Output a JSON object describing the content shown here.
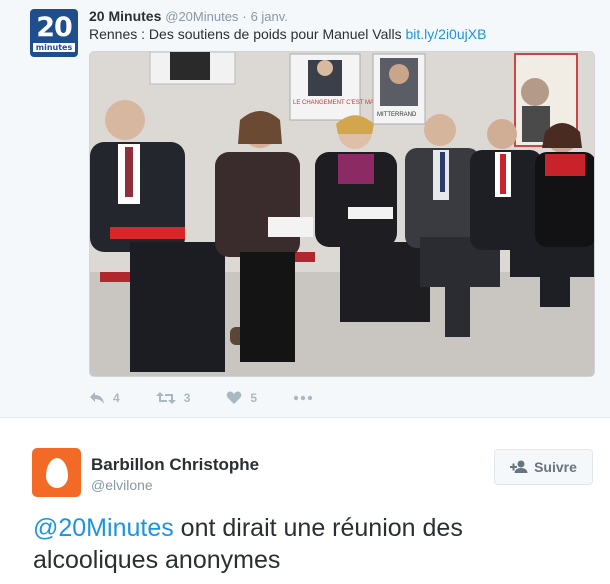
{
  "quoted_tweet": {
    "author_name": "20 Minutes",
    "handle": "@20Minutes",
    "separator": "·",
    "time": "6 janv.",
    "text": "Rennes : Des soutiens de poids pour Manuel Valls",
    "link": "bit.ly/2i0ujXB",
    "logo": {
      "big": "20",
      "small": "minutes",
      "color": "#1f4e8f"
    },
    "photo": {
      "poster_texts": [
        "LE CHANGEMENT C'EST MAINTENANT",
        "MITTERRAND"
      ]
    },
    "actions": {
      "reply": {
        "icon": "reply-icon",
        "count": "4"
      },
      "retweet": {
        "icon": "retweet-icon",
        "count": "3"
      },
      "like": {
        "icon": "heart-icon",
        "count": "5"
      },
      "more": {
        "icon": "more-icon"
      }
    }
  },
  "reply_tweet": {
    "author_name": "Barbillon Christophe",
    "handle": "@elvilone",
    "avatar_color": "#f26a26",
    "follow_label": "Suivre",
    "mention": "@20Minutes",
    "text": " ont dirait une réunion des alcooliques anonymes"
  },
  "colors": {
    "link": "#1b95e0",
    "muted": "#8899a6",
    "action": "#aab8c2"
  }
}
